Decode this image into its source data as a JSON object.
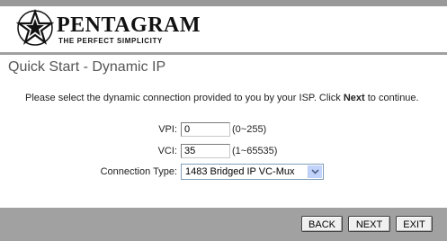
{
  "brand": {
    "name": "PENTAGRAM",
    "tagline": "THE PERFECT SIMPLICITY"
  },
  "page": {
    "title": "Quick Start - Dynamic IP"
  },
  "instruction": {
    "prefix": "Please select the dynamic connection provided to you by your ISP. Click ",
    "emphasis": "Next",
    "suffix": " to continue."
  },
  "form": {
    "vpi": {
      "label": "VPI:",
      "value": "0",
      "hint": "(0~255)"
    },
    "vci": {
      "label": "VCI:",
      "value": "35",
      "hint": "(1~65535)"
    },
    "connection_type": {
      "label": "Connection Type:",
      "selected": "1483 Bridged IP VC-Mux"
    }
  },
  "buttons": {
    "back": "BACK",
    "next": "NEXT",
    "exit": "EXIT"
  },
  "colors": {
    "header_rule": "#a0a0a0",
    "footer_bar": "#a1a1a1",
    "title_text": "#555555"
  }
}
